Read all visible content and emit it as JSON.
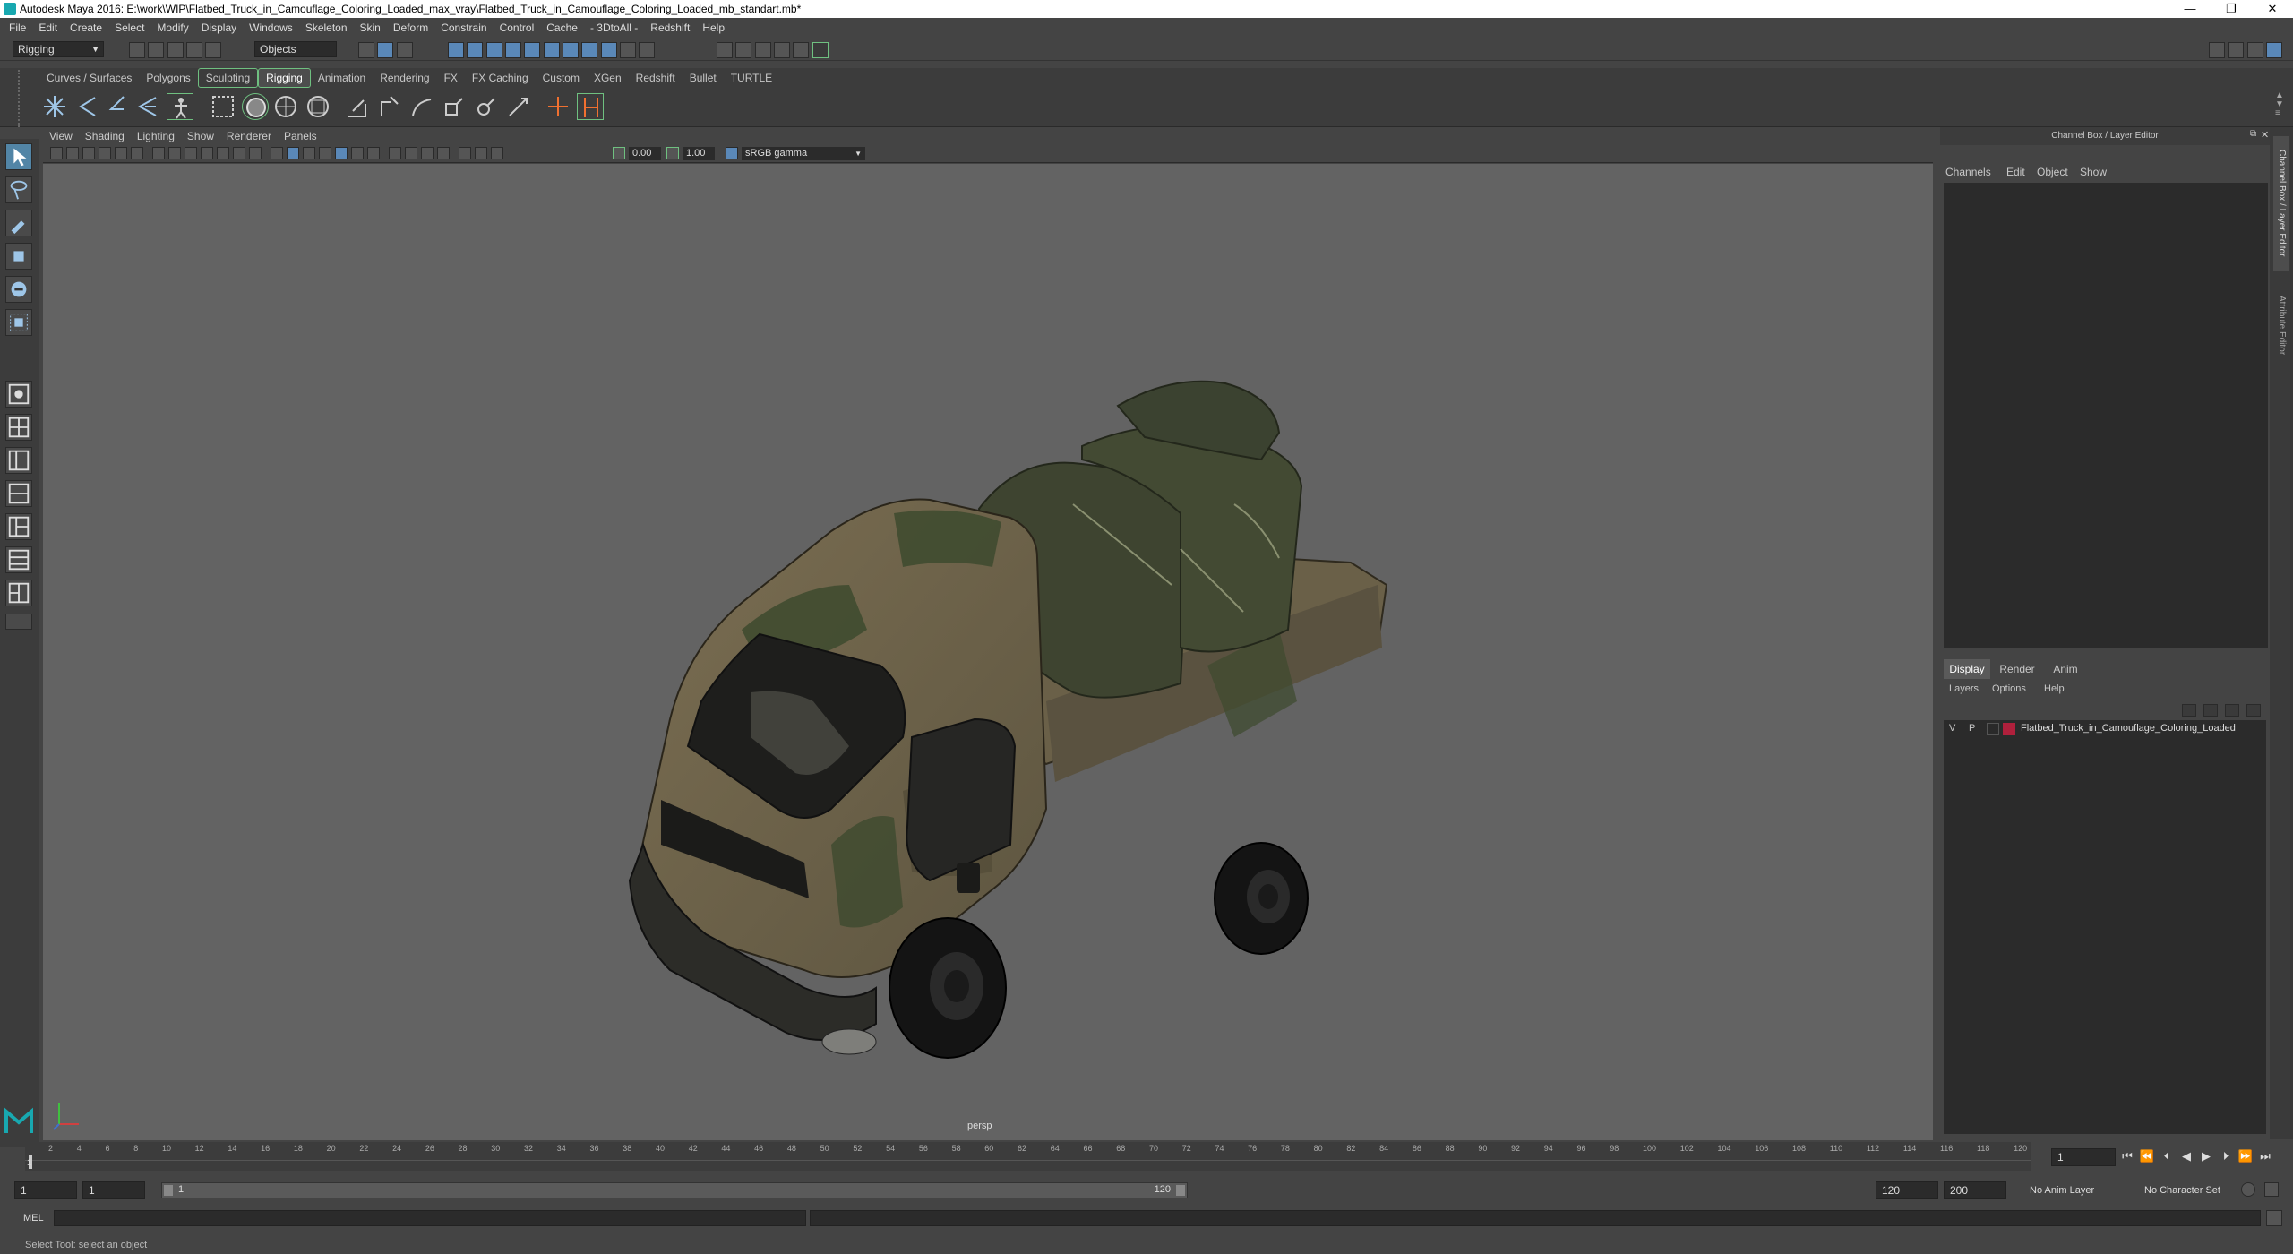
{
  "titlebar": {
    "title": "Autodesk Maya 2016: E:\\work\\WIP\\Flatbed_Truck_in_Camouflage_Coloring_Loaded_max_vray\\Flatbed_Truck_in_Camouflage_Coloring_Loaded_mb_standart.mb*",
    "minimize": "—",
    "restore": "❐",
    "close": "✕"
  },
  "menubar": [
    "File",
    "Edit",
    "Create",
    "Select",
    "Modify",
    "Display",
    "Windows",
    "Skeleton",
    "Skin",
    "Deform",
    "Constrain",
    "Control",
    "Cache",
    "- 3DtoAll -",
    "Redshift",
    "Help"
  ],
  "statusline": {
    "mode": "Rigging",
    "selection_mode": "Objects"
  },
  "shelf_tabs": {
    "tabs": [
      "Curves / Surfaces",
      "Polygons",
      "Sculpting",
      "Rigging",
      "Animation",
      "Rendering",
      "FX",
      "FX Caching",
      "Custom",
      "XGen",
      "Redshift",
      "Bullet",
      "TURTLE"
    ],
    "active": "Rigging"
  },
  "viewport": {
    "menu": [
      "View",
      "Shading",
      "Lighting",
      "Show",
      "Renderer",
      "Panels"
    ],
    "exposure": "0.00",
    "gamma": "1.00",
    "color_space": "sRGB gamma",
    "camera_label": "persp"
  },
  "channel_box": {
    "header": "Channel Box / Layer Editor",
    "menu": [
      "Channels",
      "Edit",
      "Object",
      "Show"
    ]
  },
  "layer_editor": {
    "tabs": [
      "Display",
      "Render",
      "Anim"
    ],
    "active_tab": "Display",
    "menu": [
      "Layers",
      "Options",
      "Help"
    ],
    "layers": [
      {
        "visible": "V",
        "playback": "P",
        "color": "#b0203c",
        "name": "Flatbed_Truck_in_Camouflage_Coloring_Loaded"
      }
    ]
  },
  "side_tabs": [
    "Channel Box / Layer Editor",
    "Attribute Editor"
  ],
  "timeline": {
    "ticks": [
      "2",
      "4",
      "6",
      "8",
      "10",
      "12",
      "14",
      "16",
      "18",
      "20",
      "22",
      "24",
      "26",
      "28",
      "30",
      "32",
      "34",
      "36",
      "38",
      "40",
      "42",
      "44",
      "46",
      "48",
      "50",
      "52",
      "54",
      "56",
      "58",
      "60",
      "62",
      "64",
      "66",
      "68",
      "70",
      "72",
      "74",
      "76",
      "78",
      "80",
      "82",
      "84",
      "86",
      "88",
      "90",
      "92",
      "94",
      "96",
      "98",
      "100",
      "102",
      "104",
      "106",
      "108",
      "110",
      "112",
      "114",
      "116",
      "118",
      "120"
    ],
    "current_frame": "1",
    "first_tick": "1"
  },
  "range": {
    "start": "1",
    "playback_start": "1",
    "slider_start": "1",
    "slider_end": "120",
    "playback_end": "120",
    "end": "200",
    "anim_layer": "No Anim Layer",
    "character_set": "No Character Set"
  },
  "command_line": {
    "language": "MEL"
  },
  "help_line": {
    "text": "Select Tool: select an object"
  },
  "colors": {
    "accent_blue": "#5285a6",
    "active_tab_outline": "#6fc080",
    "viewport_bg": "#636363",
    "layer_color": "#b0203c"
  }
}
